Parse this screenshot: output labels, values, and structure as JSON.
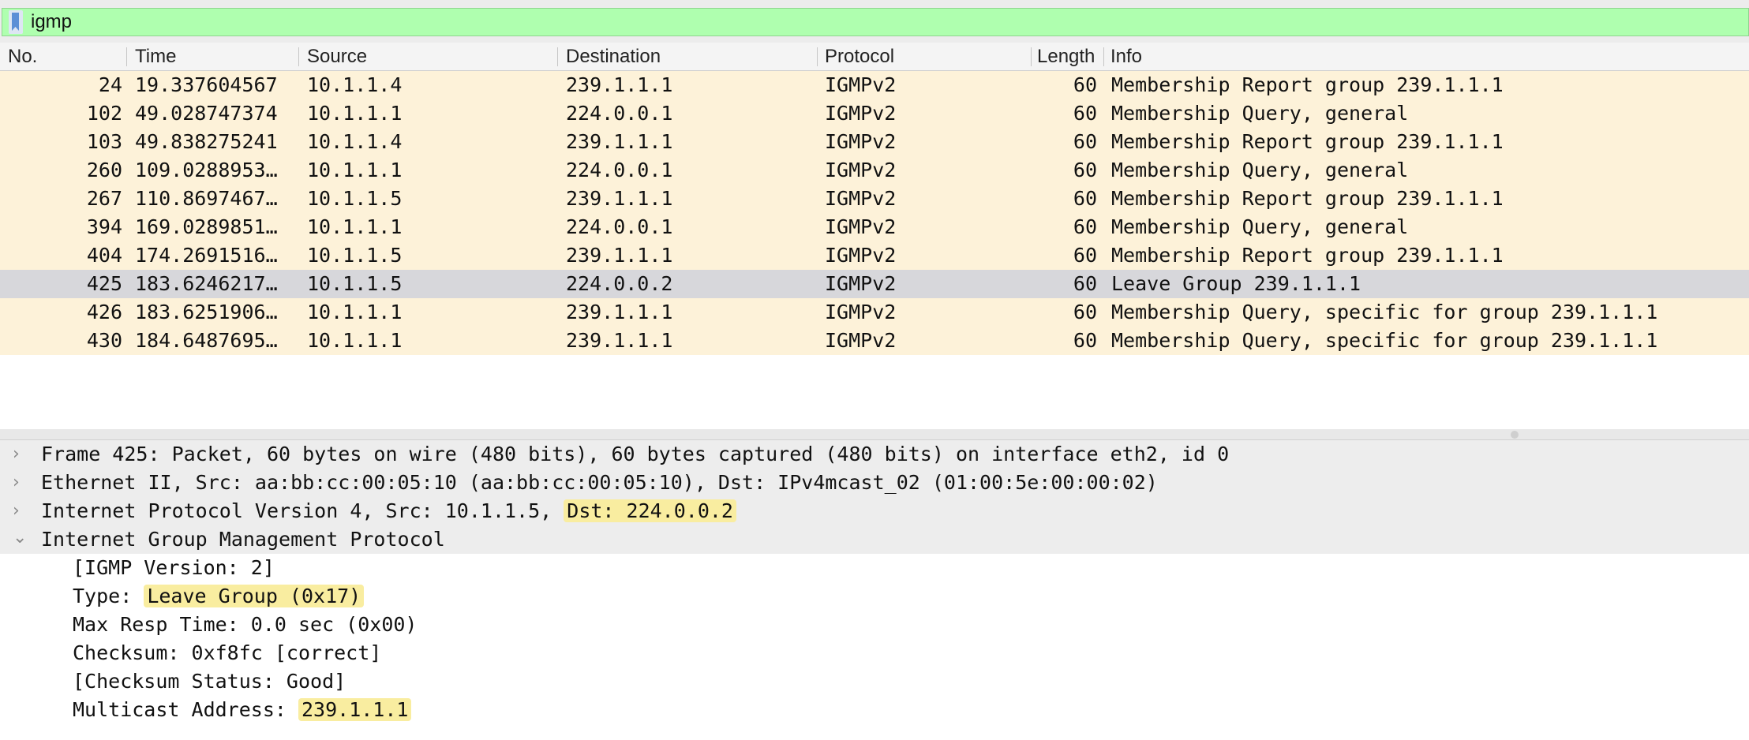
{
  "filter": {
    "icon": "bookmark-icon",
    "value": "igmp"
  },
  "columns": [
    "No.",
    "Time",
    "Source",
    "Destination",
    "Protocol",
    "Length",
    "Info"
  ],
  "packets": [
    {
      "no": "24",
      "time": "19.337604567",
      "source": "10.1.1.4",
      "destination": "239.1.1.1",
      "protocol": "IGMPv2",
      "length": "60",
      "info": "Membership Report group 239.1.1.1"
    },
    {
      "no": "102",
      "time": "49.028747374",
      "source": "10.1.1.1",
      "destination": "224.0.0.1",
      "protocol": "IGMPv2",
      "length": "60",
      "info": "Membership Query, general"
    },
    {
      "no": "103",
      "time": "49.838275241",
      "source": "10.1.1.4",
      "destination": "239.1.1.1",
      "protocol": "IGMPv2",
      "length": "60",
      "info": "Membership Report group 239.1.1.1"
    },
    {
      "no": "260",
      "time": "109.0288953…",
      "source": "10.1.1.1",
      "destination": "224.0.0.1",
      "protocol": "IGMPv2",
      "length": "60",
      "info": "Membership Query, general"
    },
    {
      "no": "267",
      "time": "110.8697467…",
      "source": "10.1.1.5",
      "destination": "239.1.1.1",
      "protocol": "IGMPv2",
      "length": "60",
      "info": "Membership Report group 239.1.1.1"
    },
    {
      "no": "394",
      "time": "169.0289851…",
      "source": "10.1.1.1",
      "destination": "224.0.0.1",
      "protocol": "IGMPv2",
      "length": "60",
      "info": "Membership Query, general"
    },
    {
      "no": "404",
      "time": "174.2691516…",
      "source": "10.1.1.5",
      "destination": "239.1.1.1",
      "protocol": "IGMPv2",
      "length": "60",
      "info": "Membership Report group 239.1.1.1"
    },
    {
      "no": "425",
      "time": "183.6246217…",
      "source": "10.1.1.5",
      "destination": "224.0.0.2",
      "protocol": "IGMPv2",
      "length": "60",
      "info": "Leave Group 239.1.1.1"
    },
    {
      "no": "426",
      "time": "183.6251906…",
      "source": "10.1.1.1",
      "destination": "239.1.1.1",
      "protocol": "IGMPv2",
      "length": "60",
      "info": "Membership Query, specific for group 239.1.1.1"
    },
    {
      "no": "430",
      "time": "184.6487695…",
      "source": "10.1.1.1",
      "destination": "239.1.1.1",
      "protocol": "IGMPv2",
      "length": "60",
      "info": "Membership Query, specific for group 239.1.1.1"
    }
  ],
  "selected_packet": "425",
  "details": {
    "frame": "Frame 425: Packet, 60 bytes on wire (480 bits), 60 bytes captured (480 bits) on interface eth2, id 0",
    "ethernet": "Ethernet II, Src: aa:bb:cc:00:05:10 (aa:bb:cc:00:05:10), Dst: IPv4mcast_02 (01:00:5e:00:00:02)",
    "ip_prefix": "Internet Protocol Version 4, Src: 10.1.1.5, ",
    "ip_dst": "Dst: 224.0.0.2",
    "igmp": "Internet Group Management Protocol",
    "igmp_fields": {
      "version": "[IGMP Version: 2]",
      "type_label": "Type: ",
      "type_value": "Leave Group (0x17)",
      "max_resp": "Max Resp Time: 0.0 sec (0x00)",
      "checksum": "Checksum: 0xf8fc [correct]",
      "checksum_status": "[Checksum Status: Good]",
      "mcast_label": "Multicast Address: ",
      "mcast_value": "239.1.1.1"
    }
  },
  "colors": {
    "filter_bg": "#afffaf",
    "row_bg": "#fdf2d9",
    "selected_bg": "#d7d7db",
    "highlight": "#f9eda0"
  }
}
